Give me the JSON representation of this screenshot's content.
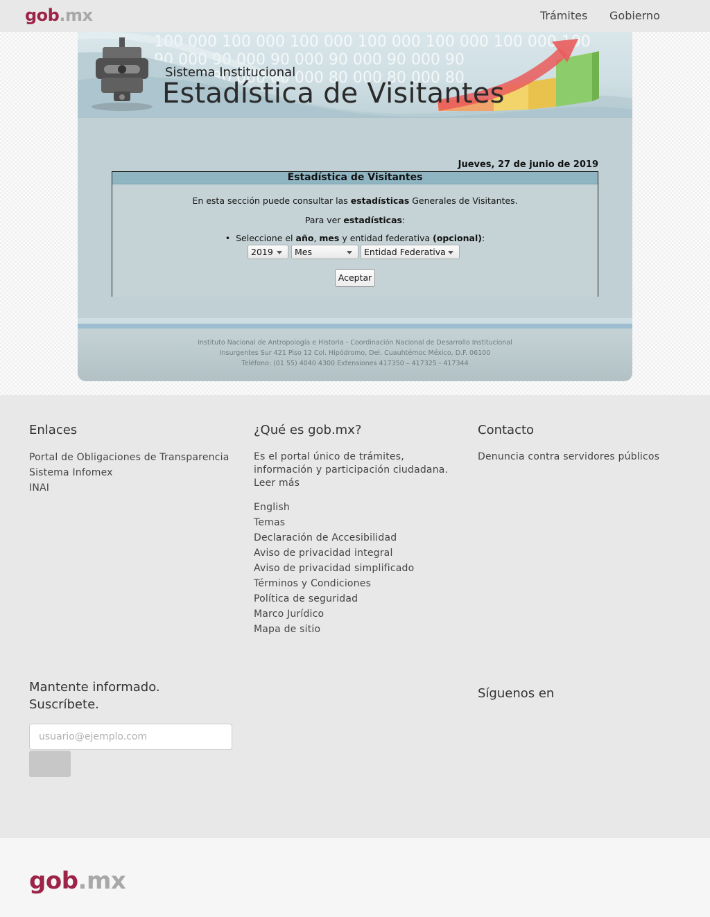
{
  "nav": {
    "logo_gob": "gob",
    "logo_mx": ".mx",
    "links": [
      "Trámites",
      "Gobierno"
    ]
  },
  "banner": {
    "subtitle": "Sistema Institucional",
    "title": "Estadística de Visitantes",
    "numbers_row1": "100 000   100 000   100 000   100 000   100 000   100 000   100",
    "numbers_row2": "90 000     90 000     90 000     90 000     90 000     90",
    "numbers_row3": "80 000     80 000     80 000     80 000     80 000     80"
  },
  "app": {
    "date": "Jueves, 27 de junio de 2019",
    "panel_title": "Estadística de Visitantes",
    "intro_pre": "En esta sección puede consultar las ",
    "intro_bold": "estadísticas",
    "intro_post": " Generales de Visitantes.",
    "para_pre": "Para ver ",
    "para_bold": "estadísticas",
    "para_post": ":",
    "bullet_pre": "Seleccione el ",
    "bullet_b1": "año",
    "bullet_sep1": ", ",
    "bullet_b2": "mes",
    "bullet_mid": " y entidad federativa ",
    "bullet_b3": "(opcional)",
    "bullet_end": ":",
    "select_year": "2019",
    "select_month": "Mes",
    "select_state": "Entidad Federativa",
    "accept_label": "Aceptar",
    "footer_line1": "Instituto Nacional de Antropología e Historia - Coordinación Nacional de Desarrollo Institucional",
    "footer_line2": "Insurgentes Sur 421 Piso 12 Col. Hipódromo, Del. Cuauhtémoc México, D.F. 06100",
    "footer_line3": "Teléfono: (01 55) 4040 4300 Extensiones 417350 – 417325 - 417344"
  },
  "footer": {
    "enlaces_title": "Enlaces",
    "enlaces": [
      "Portal de Obligaciones de Transparencia",
      "Sistema Infomex",
      "INAI"
    ],
    "que_es_title": "¿Qué es gob.mx?",
    "que_es_line1": "Es el portal único de trámites,",
    "que_es_line2": "información y participación ciudadana.",
    "leer_mas": "Leer más",
    "que_es_links": [
      "English",
      "Temas",
      "Declaración de Accesibilidad",
      "Aviso de privacidad integral",
      "Aviso de privacidad simplificado",
      "Términos y Condiciones",
      "Política de seguridad",
      "Marco Jurídico",
      "Mapa de sitio"
    ],
    "contacto_title": "Contacto",
    "contacto_link": "Denuncia contra servidores públicos",
    "mantente_line1": "Mantente informado.",
    "mantente_line2": "Suscríbete.",
    "email_placeholder": "usuario@ejemplo.com",
    "siguenos": "Síguenos en"
  },
  "bottom": {
    "logo_gob": "gob",
    "logo_mx": ".mx"
  },
  "colors": {
    "brand": "#9d2449",
    "panel_header": "#8fb5c2",
    "app_bg": "#c0d0d5"
  }
}
